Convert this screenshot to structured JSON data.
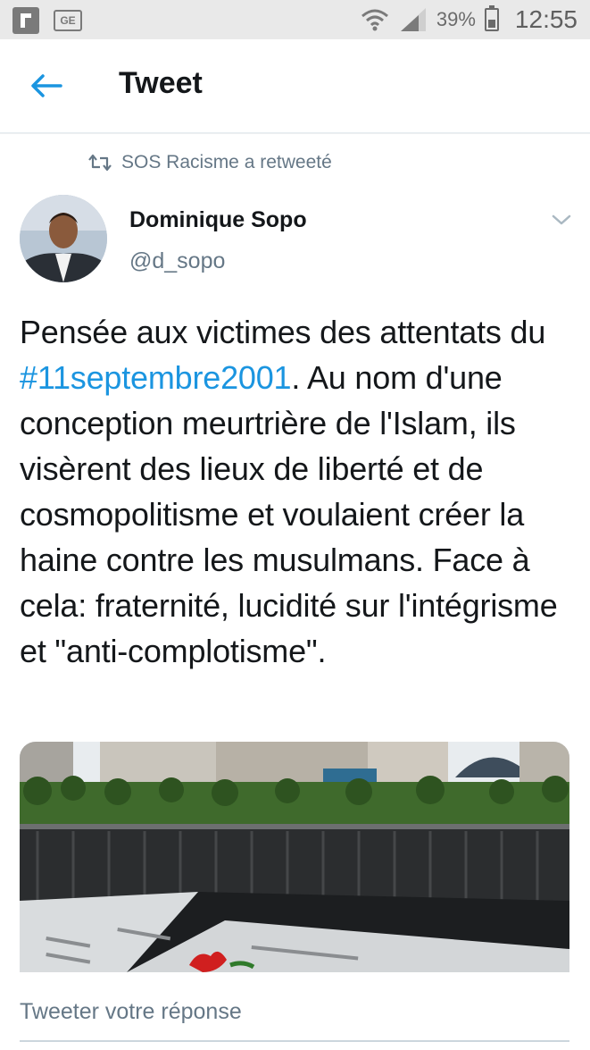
{
  "status_bar": {
    "left_icons": [
      "flipboard-icon",
      "ge-icon"
    ],
    "ge_label": "GE",
    "battery_percent": "39%",
    "time": "12:55"
  },
  "header": {
    "title": "Tweet"
  },
  "retweet": {
    "text": "SOS Racisme a retweeté"
  },
  "author": {
    "name": "Dominique Sopo",
    "handle": "@d_sopo"
  },
  "tweet": {
    "text_before": "Pensée aux victimes des attentats du ",
    "hashtag": "#11septembre2001",
    "text_after": ". Au nom d'une conception meurtrière de l'Islam, ils visèrent des lieux de liberté et de cosmopolitisme et voulaient créer la haine contre les musulmans. Face à cela: fraternité, lucidité sur l'intégrisme et \"anti-complotisme\"."
  },
  "reply": {
    "placeholder": "Tweeter votre réponse"
  },
  "colors": {
    "accent": "#1b95e0",
    "text": "#14171a",
    "secondary": "#657786",
    "status_bar_bg": "#e9e9e9"
  }
}
